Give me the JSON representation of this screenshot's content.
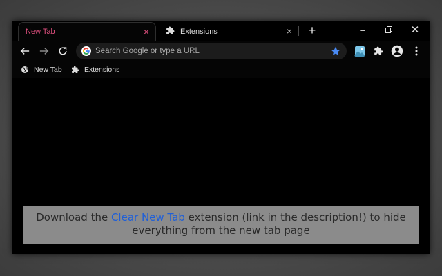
{
  "tabs": [
    {
      "title": "New Tab",
      "active": true,
      "close_symbol": "×"
    },
    {
      "title": "Extensions",
      "active": false,
      "icon": "puzzle-icon",
      "close_symbol": "×"
    }
  ],
  "tabstrip": {
    "new_tab_symbol": "+",
    "window_controls": {
      "minimize": "–",
      "restore": "❐",
      "close": "✕"
    }
  },
  "toolbar": {
    "omnibox_placeholder": "Search Google or type a URL",
    "omnibox_value": "",
    "icons": [
      "back-icon",
      "forward-icon",
      "reload-icon",
      "google-icon",
      "star-icon",
      "image-extension-icon",
      "puzzle-icon",
      "profile-icon",
      "menu-dots-icon"
    ]
  },
  "bookmarks": [
    {
      "label": "New Tab",
      "icon": "globe-icon"
    },
    {
      "label": "Extensions",
      "icon": "puzzle-icon"
    }
  ],
  "caption": {
    "before": "Download the ",
    "link": "Clear New Tab",
    "after": " extension (link in the description!) to hide everything from the new tab page"
  },
  "colors": {
    "active_tab_text": "#e0507f",
    "link": "#1f5fd8",
    "star": "#4a8bf5",
    "browser_bg": "#000000",
    "omnibox_bg": "#1c1c1c",
    "caption_bg": "#969696"
  }
}
